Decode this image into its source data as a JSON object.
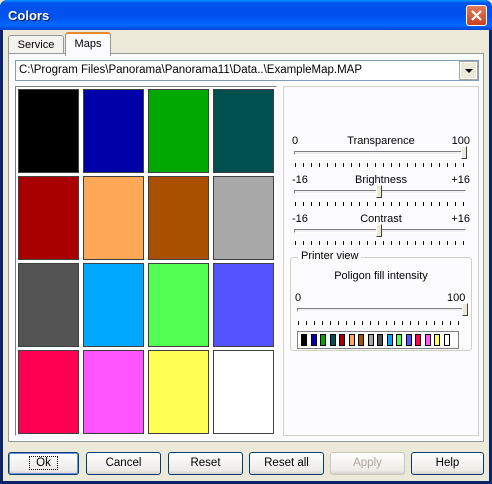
{
  "window": {
    "title": "Colors"
  },
  "tabs": [
    {
      "label": "Service"
    },
    {
      "label": "Maps"
    }
  ],
  "map_path": "C:\\Program Files\\Panorama\\Panorama11\\Data..\\ExampleMap.MAP",
  "swatches": [
    "#000000",
    "#0000A8",
    "#00A800",
    "#005050",
    "#A80000",
    "#FFA858",
    "#A85000",
    "#A8A8A8",
    "#545454",
    "#00A8FF",
    "#54FF54",
    "#5454FF",
    "#FF0054",
    "#FF54FF",
    "#FFFF54",
    "#FFFFFF"
  ],
  "sliders": {
    "transparence": {
      "label": "Transparence",
      "min_label": "0",
      "max_label": "100",
      "level": 1.0
    },
    "brightness": {
      "label": "Brightness",
      "min_label": "-16",
      "max_label": "+16",
      "level": 0.5
    },
    "contrast": {
      "label": "Contrast",
      "min_label": "-16",
      "max_label": "+16",
      "level": 0.5
    }
  },
  "printer_view": {
    "title": "Printer view",
    "intensity": {
      "label": "Poligon fill intensity",
      "min_label": "0",
      "max_label": "100",
      "level": 1.0
    },
    "palette": [
      "#000000",
      "#0000A8",
      "#00A800",
      "#005050",
      "#A80000",
      "#FFA858",
      "#A85000",
      "#A8A8A8",
      "#545454",
      "#00A8FF",
      "#54FF54",
      "#5454FF",
      "#FF0054",
      "#FF54FF",
      "#FFFF54",
      "#FFFFFF"
    ]
  },
  "buttons": {
    "ok": "Ok",
    "cancel": "Cancel",
    "reset": "Reset",
    "reset_all": "Reset all",
    "apply": "Apply",
    "help": "Help"
  }
}
